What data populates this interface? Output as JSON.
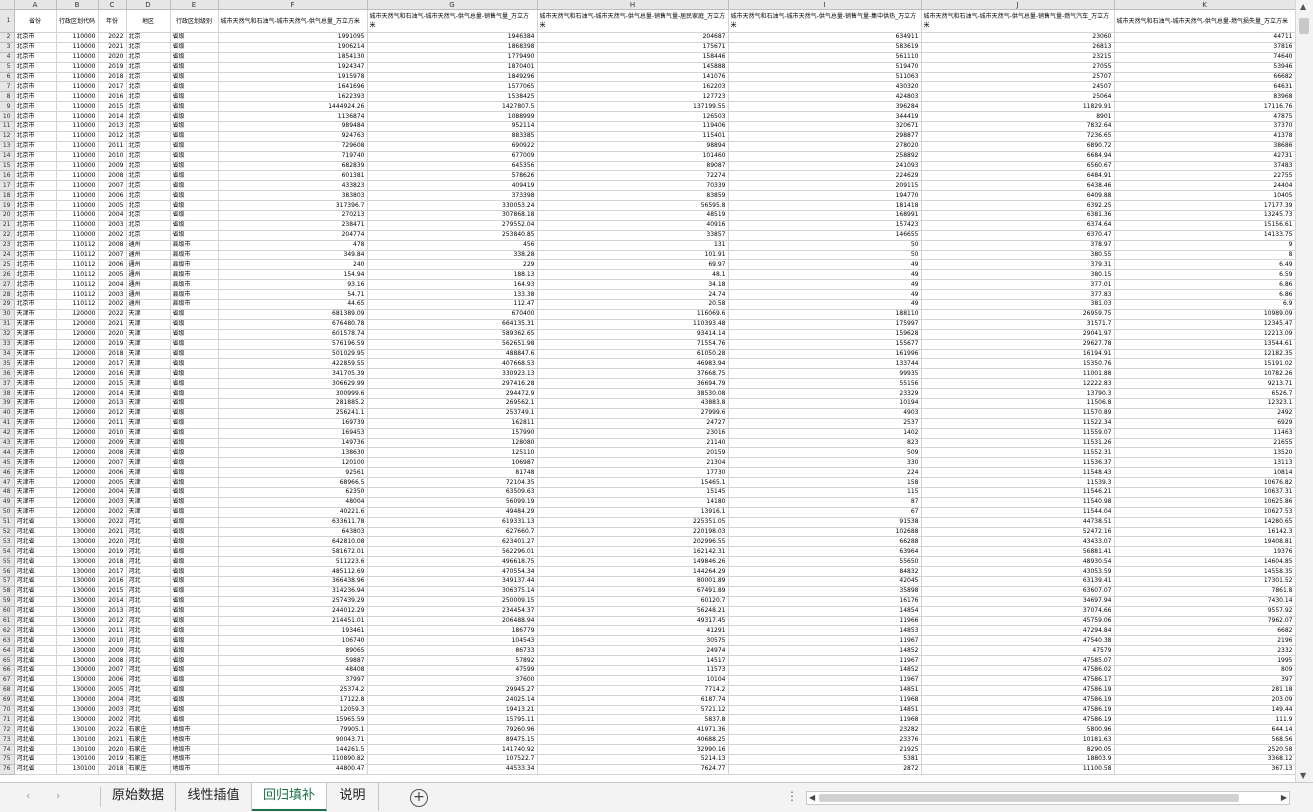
{
  "columns": [
    "A",
    "B",
    "C",
    "D",
    "E",
    "F",
    "G",
    "H",
    "I",
    "J",
    "K"
  ],
  "headers": [
    "省份",
    "行政区划代码",
    "年份",
    "地区",
    "行政区划级别",
    "城市天然气和石油气-城市天然气-供气总量_万立方米",
    "城市天然气和石油气-城市天然气-供气总量-销售气量_万立方米",
    "城市天然气和石油气-城市天然气-供气总量-销售气量-居民家庭_万立方米",
    "城市天然气和石油气-城市天然气-供气总量-销售气量-集中供热_万立方米",
    "城市天然气和石油气-城市天然气-供气总量-销售气量-燃气汽车_万立方米",
    "城市天然气和石油气-城市天然气-供气总量-燃气损失量_万立方米"
  ],
  "rows": [
    [
      "北京市",
      "110000",
      "2022",
      "北京",
      "省级",
      "1991095",
      "1946384",
      "204687",
      "634911",
      "23060",
      "44711"
    ],
    [
      "北京市",
      "110000",
      "2021",
      "北京",
      "省级",
      "1906214",
      "1868398",
      "175671",
      "583619",
      "26813",
      "37816"
    ],
    [
      "北京市",
      "110000",
      "2020",
      "北京",
      "省级",
      "1854130",
      "1779490",
      "158446",
      "561110",
      "23215",
      "74640"
    ],
    [
      "北京市",
      "110000",
      "2019",
      "北京",
      "省级",
      "1924347",
      "1870401",
      "145888",
      "519470",
      "27055",
      "53946"
    ],
    [
      "北京市",
      "110000",
      "2018",
      "北京",
      "省级",
      "1915978",
      "1849296",
      "141076",
      "511063",
      "25707",
      "66682"
    ],
    [
      "北京市",
      "110000",
      "2017",
      "北京",
      "省级",
      "1641696",
      "1577065",
      "162203",
      "430320",
      "24507",
      "64631"
    ],
    [
      "北京市",
      "110000",
      "2016",
      "北京",
      "省级",
      "1622393",
      "1538425",
      "127723",
      "424803",
      "25064",
      "83968"
    ],
    [
      "北京市",
      "110000",
      "2015",
      "北京",
      "省级",
      "1444924.26",
      "1427807.5",
      "137199.55",
      "396284",
      "11829.91",
      "17116.76"
    ],
    [
      "北京市",
      "110000",
      "2014",
      "北京",
      "省级",
      "1136874",
      "1088999",
      "126503",
      "344419",
      "8901",
      "47875"
    ],
    [
      "北京市",
      "110000",
      "2013",
      "北京",
      "省级",
      "989484",
      "952114",
      "119406",
      "320671",
      "7832.64",
      "37370"
    ],
    [
      "北京市",
      "110000",
      "2012",
      "北京",
      "省级",
      "924763",
      "883385",
      "115401",
      "298877",
      "7236.65",
      "41378"
    ],
    [
      "北京市",
      "110000",
      "2011",
      "北京",
      "省级",
      "729608",
      "690922",
      "98894",
      "278020",
      "6890.72",
      "38686"
    ],
    [
      "北京市",
      "110000",
      "2010",
      "北京",
      "省级",
      "719740",
      "677009",
      "101460",
      "258892",
      "6684.94",
      "42731"
    ],
    [
      "北京市",
      "110000",
      "2009",
      "北京",
      "省级",
      "682839",
      "645356",
      "89087",
      "241093",
      "6560.67",
      "37483"
    ],
    [
      "北京市",
      "110000",
      "2008",
      "北京",
      "省级",
      "601381",
      "578626",
      "72274",
      "224629",
      "6484.91",
      "22755"
    ],
    [
      "北京市",
      "110000",
      "2007",
      "北京",
      "省级",
      "433823",
      "409419",
      "70339",
      "209115",
      "6438.46",
      "24404"
    ],
    [
      "北京市",
      "110000",
      "2006",
      "北京",
      "省级",
      "383803",
      "373398",
      "83859",
      "194770",
      "6409.88",
      "10405"
    ],
    [
      "北京市",
      "110000",
      "2005",
      "北京",
      "省级",
      "317396.7",
      "330053.24",
      "56595.8",
      "181418",
      "6392.25",
      "17177.39"
    ],
    [
      "北京市",
      "110000",
      "2004",
      "北京",
      "省级",
      "270213",
      "307868.18",
      "48519",
      "168991",
      "6381.36",
      "13245.73"
    ],
    [
      "北京市",
      "110000",
      "2003",
      "北京",
      "省级",
      "238471",
      "279552.04",
      "40916",
      "157423",
      "6374.64",
      "15156.61"
    ],
    [
      "北京市",
      "110000",
      "2002",
      "北京",
      "省级",
      "204774",
      "253840.85",
      "33857",
      "146655",
      "6370.47",
      "14133.75"
    ],
    [
      "北京市",
      "110112",
      "2008",
      "通州",
      "县级市",
      "478",
      "456",
      "131",
      "50",
      "378.97",
      "9"
    ],
    [
      "北京市",
      "110112",
      "2007",
      "通州",
      "县级市",
      "349.84",
      "338.28",
      "101.91",
      "50",
      "380.55",
      "8"
    ],
    [
      "北京市",
      "110112",
      "2006",
      "通州",
      "县级市",
      "240",
      "229",
      "69.97",
      "49",
      "379.31",
      "6.49"
    ],
    [
      "北京市",
      "110112",
      "2005",
      "通州",
      "县级市",
      "154.94",
      "188.13",
      "48.1",
      "49",
      "380.15",
      "6.59"
    ],
    [
      "北京市",
      "110112",
      "2004",
      "通州",
      "县级市",
      "93.16",
      "164.93",
      "34.18",
      "49",
      "377.01",
      "6.86"
    ],
    [
      "北京市",
      "110112",
      "2003",
      "通州",
      "县级市",
      "54.71",
      "133.38",
      "24.74",
      "49",
      "377.83",
      "6.86"
    ],
    [
      "北京市",
      "110112",
      "2002",
      "通州",
      "县级市",
      "44.65",
      "112.47",
      "20.58",
      "49",
      "381.03",
      "6.9"
    ],
    [
      "天津市",
      "120000",
      "2022",
      "天津",
      "省级",
      "681389.09",
      "670400",
      "116069.6",
      "188110",
      "26959.75",
      "10989.09"
    ],
    [
      "天津市",
      "120000",
      "2021",
      "天津",
      "省级",
      "676480.78",
      "664135.31",
      "110393.48",
      "175997",
      "31571.7",
      "12345.47"
    ],
    [
      "天津市",
      "120000",
      "2020",
      "天津",
      "省级",
      "601578.74",
      "589362.65",
      "93414.14",
      "159628",
      "29041.97",
      "12213.09"
    ],
    [
      "天津市",
      "120000",
      "2019",
      "天津",
      "省级",
      "576196.59",
      "562651.98",
      "71554.76",
      "155677",
      "29627.78",
      "13544.61"
    ],
    [
      "天津市",
      "120000",
      "2018",
      "天津",
      "省级",
      "501029.95",
      "488847.6",
      "61050.28",
      "161996",
      "16194.91",
      "12182.35"
    ],
    [
      "天津市",
      "120000",
      "2017",
      "天津",
      "省级",
      "422859.55",
      "407668.53",
      "46983.94",
      "133744",
      "15350.76",
      "15191.02"
    ],
    [
      "天津市",
      "120000",
      "2016",
      "天津",
      "省级",
      "341705.39",
      "330923.13",
      "37668.75",
      "99935",
      "11001.88",
      "10782.26"
    ],
    [
      "天津市",
      "120000",
      "2015",
      "天津",
      "省级",
      "306629.99",
      "297416.28",
      "36694.79",
      "55156",
      "12222.83",
      "9213.71"
    ],
    [
      "天津市",
      "120000",
      "2014",
      "天津",
      "省级",
      "300999.6",
      "294472.9",
      "38530.08",
      "23329",
      "13790.3",
      "6526.7"
    ],
    [
      "天津市",
      "120000",
      "2013",
      "天津",
      "省级",
      "281885.2",
      "269562.1",
      "43883.8",
      "10194",
      "11506.8",
      "12323.1"
    ],
    [
      "天津市",
      "120000",
      "2012",
      "天津",
      "省级",
      "256241.1",
      "253749.1",
      "27999.6",
      "4903",
      "11570.89",
      "2492"
    ],
    [
      "天津市",
      "120000",
      "2011",
      "天津",
      "省级",
      "169739",
      "162811",
      "24727",
      "2537",
      "11522.34",
      "6929"
    ],
    [
      "天津市",
      "120000",
      "2010",
      "天津",
      "省级",
      "169453",
      "157990",
      "23016",
      "1402",
      "11559.07",
      "11463"
    ],
    [
      "天津市",
      "120000",
      "2009",
      "天津",
      "省级",
      "149736",
      "128080",
      "21140",
      "823",
      "11531.26",
      "21655"
    ],
    [
      "天津市",
      "120000",
      "2008",
      "天津",
      "省级",
      "138630",
      "125110",
      "20159",
      "509",
      "11552.31",
      "13520"
    ],
    [
      "天津市",
      "120000",
      "2007",
      "天津",
      "省级",
      "120100",
      "106987",
      "21304",
      "330",
      "11536.37",
      "13113"
    ],
    [
      "天津市",
      "120000",
      "2006",
      "天津",
      "省级",
      "92561",
      "81748",
      "17730",
      "224",
      "11548.43",
      "10814"
    ],
    [
      "天津市",
      "120000",
      "2005",
      "天津",
      "省级",
      "68966.5",
      "72104.35",
      "15465.1",
      "158",
      "11539.3",
      "10676.82"
    ],
    [
      "天津市",
      "120000",
      "2004",
      "天津",
      "省级",
      "62350",
      "63509.63",
      "15145",
      "115",
      "11546.21",
      "10637.31"
    ],
    [
      "天津市",
      "120000",
      "2003",
      "天津",
      "省级",
      "48004",
      "56099.19",
      "14180",
      "87",
      "11540.98",
      "10625.86"
    ],
    [
      "天津市",
      "120000",
      "2002",
      "天津",
      "省级",
      "40221.6",
      "49484.29",
      "13916.1",
      "67",
      "11544.04",
      "10627.53"
    ],
    [
      "河北省",
      "130000",
      "2022",
      "河北",
      "省级",
      "633611.78",
      "619331.13",
      "225351.05",
      "91538",
      "44738.51",
      "14280.65"
    ],
    [
      "河北省",
      "130000",
      "2021",
      "河北",
      "省级",
      "643803",
      "627660.7",
      "220198.03",
      "102688",
      "52472.16",
      "16142.3"
    ],
    [
      "河北省",
      "130000",
      "2020",
      "河北",
      "省级",
      "642810.08",
      "623401.27",
      "202996.55",
      "66288",
      "43433.07",
      "19408.81"
    ],
    [
      "河北省",
      "130000",
      "2019",
      "河北",
      "省级",
      "581672.01",
      "562296.01",
      "162142.31",
      "63964",
      "56881.41",
      "19376"
    ],
    [
      "河北省",
      "130000",
      "2018",
      "河北",
      "省级",
      "511223.6",
      "496618.75",
      "149846.26",
      "55650",
      "48930.54",
      "14604.85"
    ],
    [
      "河北省",
      "130000",
      "2017",
      "河北",
      "省级",
      "485112.69",
      "470554.34",
      "144264.29",
      "84832",
      "43053.59",
      "14558.35"
    ],
    [
      "河北省",
      "130000",
      "2016",
      "河北",
      "省级",
      "366438.96",
      "349137.44",
      "80001.89",
      "42045",
      "63139.41",
      "17301.52"
    ],
    [
      "河北省",
      "130000",
      "2015",
      "河北",
      "省级",
      "314236.94",
      "306375.14",
      "67491.89",
      "35898",
      "63607.07",
      "7861.8"
    ],
    [
      "河北省",
      "130000",
      "2014",
      "河北",
      "省级",
      "257439.29",
      "250009.15",
      "60120.7",
      "16176",
      "34697.94",
      "7430.14"
    ],
    [
      "河北省",
      "130000",
      "2013",
      "河北",
      "省级",
      "244012.29",
      "234454.37",
      "56248.21",
      "14854",
      "37074.66",
      "9557.92"
    ],
    [
      "河北省",
      "130000",
      "2012",
      "河北",
      "省级",
      "214451.01",
      "206488.94",
      "49317.45",
      "11966",
      "45759.06",
      "7962.07"
    ],
    [
      "河北省",
      "130000",
      "2011",
      "河北",
      "省级",
      "193461",
      "186779",
      "41291",
      "14853",
      "47294.84",
      "6682"
    ],
    [
      "河北省",
      "130000",
      "2010",
      "河北",
      "省级",
      "106740",
      "104543",
      "30575",
      "11967",
      "47540.38",
      "2196"
    ],
    [
      "河北省",
      "130000",
      "2009",
      "河北",
      "省级",
      "89065",
      "86733",
      "24974",
      "14852",
      "47579",
      "2332"
    ],
    [
      "河北省",
      "130000",
      "2008",
      "河北",
      "省级",
      "59887",
      "57892",
      "14517",
      "11967",
      "47585.07",
      "1995"
    ],
    [
      "河北省",
      "130000",
      "2007",
      "河北",
      "省级",
      "48408",
      "47599",
      "11573",
      "14852",
      "47586.02",
      "809"
    ],
    [
      "河北省",
      "130000",
      "2006",
      "河北",
      "省级",
      "37997",
      "37600",
      "10104",
      "11967",
      "47586.17",
      "397"
    ],
    [
      "河北省",
      "130000",
      "2005",
      "河北",
      "省级",
      "25374.2",
      "29945.27",
      "7714.2",
      "14851",
      "47586.19",
      "281.18"
    ],
    [
      "河北省",
      "130000",
      "2004",
      "河北",
      "省级",
      "17122.8",
      "24025.14",
      "6187.74",
      "11968",
      "47586.19",
      "203.09"
    ],
    [
      "河北省",
      "130000",
      "2003",
      "河北",
      "省级",
      "12059.3",
      "19413.21",
      "5721.12",
      "14851",
      "47586.19",
      "149.44"
    ],
    [
      "河北省",
      "130000",
      "2002",
      "河北",
      "省级",
      "15965.59",
      "15795.11",
      "5837.8",
      "11968",
      "47586.19",
      "111.9"
    ],
    [
      "河北省",
      "130100",
      "2022",
      "石家庄",
      "地级市",
      "79905.1",
      "79260.96",
      "41971.36",
      "23282",
      "5800.96",
      "644.14"
    ],
    [
      "河北省",
      "130100",
      "2021",
      "石家庄",
      "地级市",
      "90043.71",
      "89475.15",
      "40688.25",
      "23376",
      "10181.63",
      "568.56"
    ],
    [
      "河北省",
      "130100",
      "2020",
      "石家庄",
      "地级市",
      "144261.5",
      "141740.92",
      "32990.16",
      "21925",
      "8290.05",
      "2520.58"
    ],
    [
      "河北省",
      "130100",
      "2019",
      "石家庄",
      "地级市",
      "110890.82",
      "107522.7",
      "5214.13",
      "5381",
      "18803.9",
      "3368.12"
    ],
    [
      "河北省",
      "130100",
      "2018",
      "石家庄",
      "地级市",
      "44800.47",
      "44533.34",
      "7624.77",
      "2872",
      "11100.58",
      "367.13"
    ]
  ],
  "tabs": [
    {
      "label": "原始数据",
      "active": false
    },
    {
      "label": "线性插值",
      "active": false
    },
    {
      "label": "回归填补",
      "active": true
    },
    {
      "label": "说明",
      "active": false
    }
  ],
  "icons": {
    "add_sheet": "plus-circle-icon",
    "more": "ellipsis-icon",
    "nav_left": "chevron-left-icon",
    "nav_right": "chevron-right-icon"
  },
  "accent_color": "#1e7145"
}
